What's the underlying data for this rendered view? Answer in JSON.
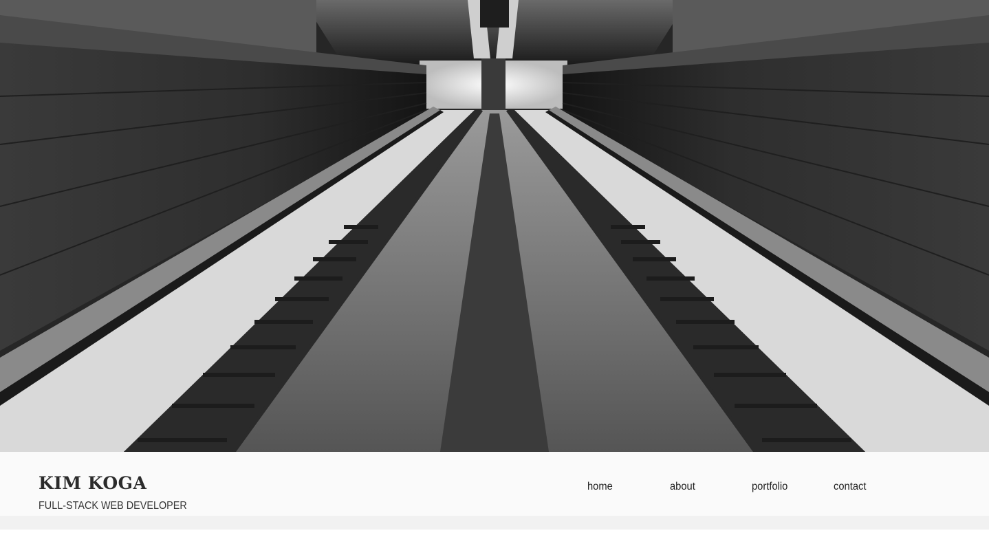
{
  "brand": {
    "name": "KIM KOGA",
    "tagline": "FULL-STACK WEB DEVELOPER"
  },
  "nav": {
    "items": [
      {
        "label": "home"
      },
      {
        "label": "about"
      },
      {
        "label": "portfolio"
      },
      {
        "label": "contact"
      }
    ]
  },
  "hero": {
    "image": "black-and-white-railway-tunnel-photo"
  },
  "colors": {
    "header_bg": "#fafafa",
    "text": "#222222"
  }
}
